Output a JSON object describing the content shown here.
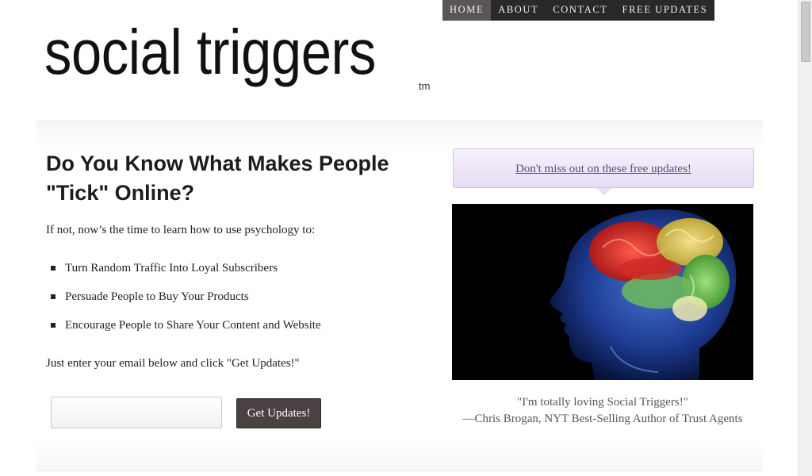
{
  "nav": {
    "items": [
      {
        "label": "HOME",
        "active": true
      },
      {
        "label": "ABOUT",
        "active": false
      },
      {
        "label": "CONTACT",
        "active": false
      },
      {
        "label": "FREE UPDATES",
        "active": false
      }
    ]
  },
  "logo": {
    "text": "social triggers",
    "tm": "tm"
  },
  "main": {
    "headline": "Do You Know What Makes People \"Tick\" Online?",
    "intro": "If not, now’s the time to learn how to use psychology to:",
    "bullets": [
      "Turn Random Traffic Into Loyal Subscribers",
      "Persuade People to Buy Your Products",
      "Encourage People to Share Your Content and Website"
    ],
    "instruction": "Just enter your email below and click \"Get Updates!\"",
    "email_value": "",
    "button_label": "Get Updates!"
  },
  "sidebar": {
    "callout_link": "Don't miss out on these free updates!",
    "quote_line1": "\"I'm totally loving Social Triggers!\"",
    "quote_line2": "—Chris Brogan, NYT Best-Selling Author of Trust Agents"
  },
  "colors": {
    "nav_bg": "#2b2828",
    "nav_active": "#5b5656",
    "button_bg": "#4a4142",
    "callout_bg": "#e7ddf4",
    "link": "#5a4b7c"
  }
}
